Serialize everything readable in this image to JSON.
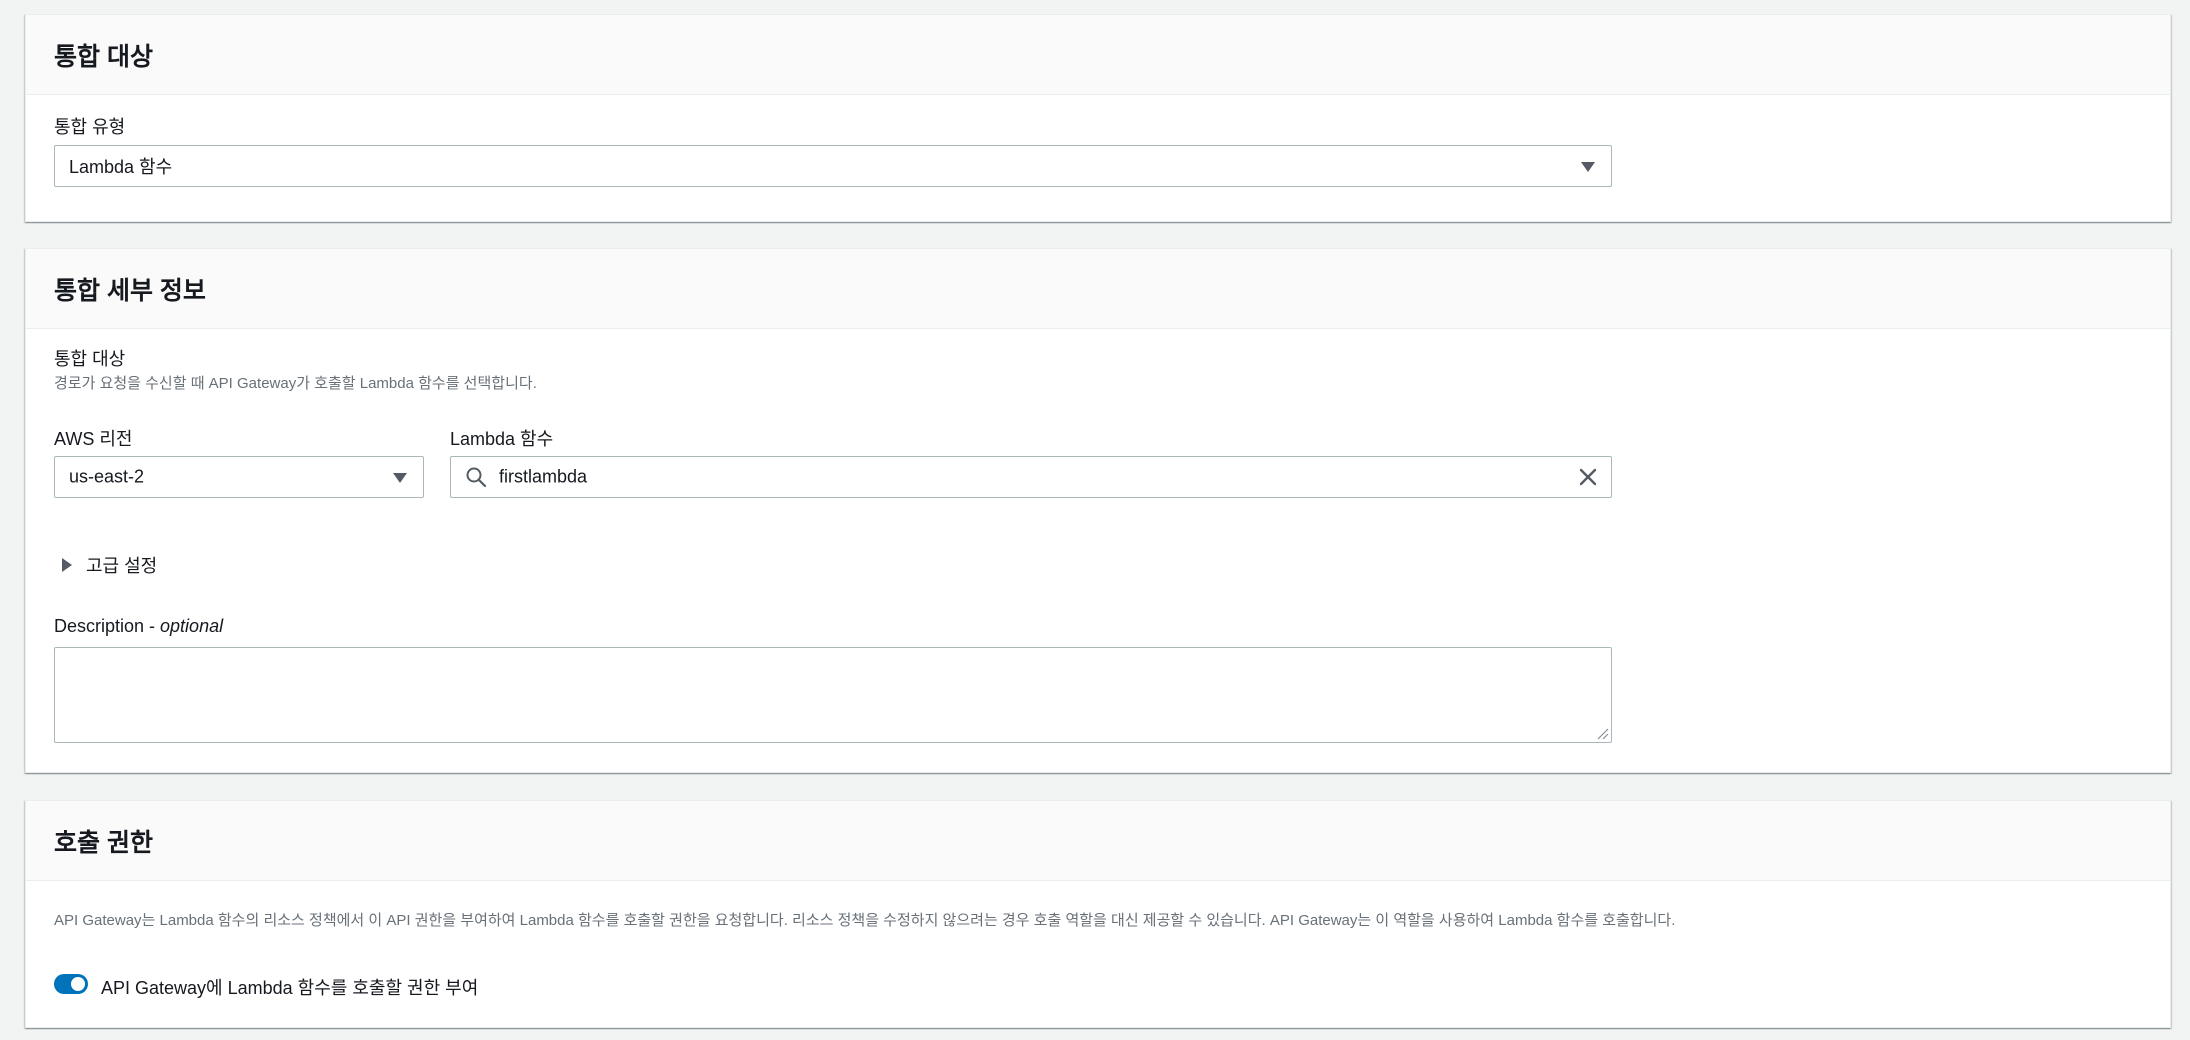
{
  "panels": {
    "integration_target": {
      "title": "통합 대상",
      "type_label": "통합 유형",
      "type_value": "Lambda 함수"
    },
    "integration_details": {
      "title": "통합 세부 정보",
      "target_label": "통합 대상",
      "target_description": "경로가 요청을 수신할 때 API Gateway가 호출할 Lambda 함수를 선택합니다.",
      "region_label": "AWS 리전",
      "region_value": "us-east-2",
      "function_label": "Lambda 함수",
      "function_value": "firstlambda",
      "advanced_label": "고급 설정",
      "description_label": "Description - ",
      "description_optional": "optional",
      "description_value": ""
    },
    "invoke_permission": {
      "title": "호출 권한",
      "description": "API Gateway는 Lambda 함수의 리소스 정책에서 이 API 권한을 부여하여 Lambda 함수를 호출할 권한을 요청합니다. 리소스 정책을 수정하지 않으려는 경우 호출 역할을 대신 제공할 수 있습니다. API Gateway는 이 역할을 사용하여 Lambda 함수를 호출합니다.",
      "toggle_label": "API Gateway에 Lambda 함수를 호출할 권한 부여",
      "toggle_on": true
    }
  },
  "icons": {
    "dropdown": "caret-down-icon",
    "search": "search-icon",
    "clear": "close-icon",
    "expand": "caret-right-icon"
  },
  "colors": {
    "accent": "#0073bb",
    "page_background": "#f2f3f3",
    "header_background": "#fafafa",
    "border": "#aab7b8",
    "secondary_text": "#687078"
  }
}
